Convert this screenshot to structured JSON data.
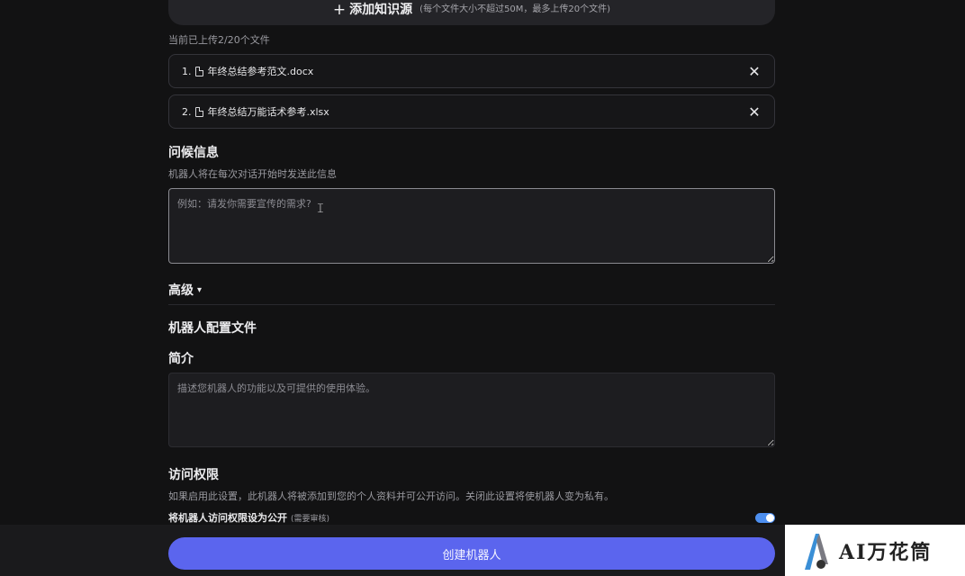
{
  "knowledge": {
    "add_label": "添加知识源",
    "add_hint": "(每个文件大小不超过50M，最多上传20个文件)",
    "upload_count": "当前已上传2/20个文件",
    "files": [
      {
        "index": "1.",
        "name": "年终总结参考范文.docx"
      },
      {
        "index": "2.",
        "name": "年终总结万能话术参考.xlsx"
      }
    ]
  },
  "greeting": {
    "title": "问候信息",
    "description": "机器人将在每次对话开始时发送此信息",
    "placeholder": "例如：请发你需要宣传的需求?"
  },
  "advanced": {
    "label": "高级"
  },
  "profile": {
    "title": "机器人配置文件"
  },
  "intro": {
    "title": "简介",
    "placeholder": "描述您机器人的功能以及可提供的使用体验。"
  },
  "access": {
    "title": "访问权限",
    "description": "如果启用此设置，此机器人将被添加到您的个人资料并可公开访问。关闭此设置将使机器人变为私有。",
    "toggle_label": "将机器人访问权限设为公开",
    "toggle_note": "(需要审核)",
    "toggle_on": true
  },
  "create_button": "创建机器人",
  "watermark": {
    "text": "AI万花筒"
  },
  "colors": {
    "accent": "#5b65ee",
    "toggle": "#4d8ff0",
    "background": "#121213"
  }
}
